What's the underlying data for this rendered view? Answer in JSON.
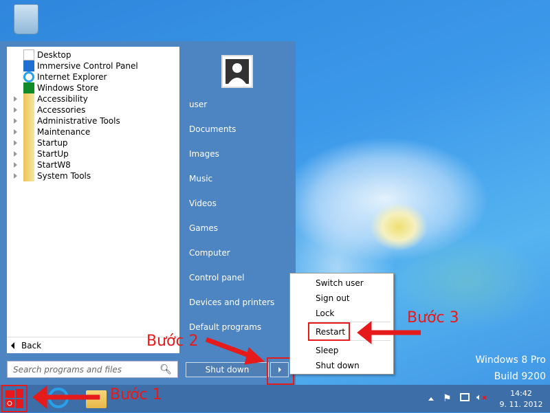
{
  "desktop": {
    "recycle_bin": "recycle-bin-icon",
    "watermark_line1": "Windows 8 Pro",
    "watermark_line2": "Build 9200"
  },
  "start_menu": {
    "programs": [
      {
        "label": "Desktop",
        "icon": "desktop-icon",
        "folder": false
      },
      {
        "label": "Immersive Control Panel",
        "icon": "gear-icon",
        "folder": false
      },
      {
        "label": "Internet Explorer",
        "icon": "ie-icon",
        "folder": false
      },
      {
        "label": "Windows Store",
        "icon": "store-icon",
        "folder": false
      },
      {
        "label": "Accessibility",
        "icon": "folder-icon",
        "folder": true
      },
      {
        "label": "Accessories",
        "icon": "folder-icon",
        "folder": true
      },
      {
        "label": "Administrative Tools",
        "icon": "folder-icon",
        "folder": true
      },
      {
        "label": "Maintenance",
        "icon": "folder-icon",
        "folder": true
      },
      {
        "label": "Startup",
        "icon": "folder-icon",
        "folder": true
      },
      {
        "label": "StartUp",
        "icon": "folder-icon",
        "folder": true
      },
      {
        "label": "StartW8",
        "icon": "folder-icon",
        "folder": true
      },
      {
        "label": "System Tools",
        "icon": "folder-icon",
        "folder": true
      }
    ],
    "back_label": "Back",
    "search_placeholder": "Search programs and files",
    "right_items": [
      "user",
      "Documents",
      "Images",
      "Music",
      "Videos",
      "Games",
      "Computer",
      "Control panel",
      "Devices and printers",
      "Default programs"
    ],
    "shutdown_label": "Shut down"
  },
  "context_menu": {
    "items": [
      "Switch user",
      "Sign out",
      "Lock",
      "Restart",
      "Sleep",
      "Shut down"
    ],
    "highlighted": "Restart"
  },
  "annotations": {
    "step1": "Bước 1",
    "step2": "Bước 2",
    "step3": "Bước 3",
    "color": "#e51a1a"
  },
  "taskbar": {
    "time": "14:42",
    "date": "9. 11. 2012"
  }
}
